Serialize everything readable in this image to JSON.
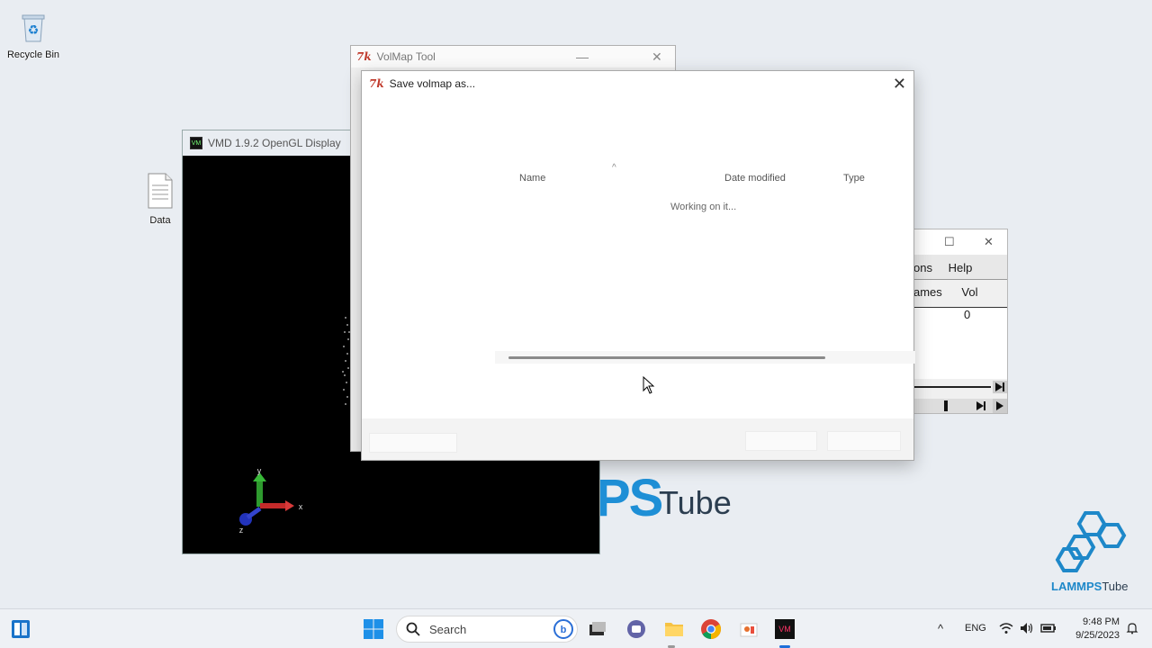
{
  "desktop": {
    "icons": [
      {
        "label": "Recycle Bin",
        "icon": "recycle-bin-icon"
      },
      {
        "label": "Data",
        "icon": "text-file-icon"
      }
    ],
    "wallpaper_brand": {
      "ps": "PS",
      "tube": "Tube",
      "logo_main": "LAMMPS",
      "logo_tube": "Tube"
    }
  },
  "vmd_display": {
    "title": "VMD 1.9.2 OpenGL Display",
    "axes": {
      "x": "x",
      "y": "y",
      "z": "z"
    }
  },
  "vmd_main_partial": {
    "menu": [
      "ons",
      "Help"
    ],
    "columns": [
      "ames",
      "Vol"
    ],
    "rows": [
      {
        "vol": "0"
      }
    ]
  },
  "volmap_tool": {
    "title": "VolMap Tool"
  },
  "save_dialog": {
    "title": "Save volmap as...",
    "columns": {
      "name": "Name",
      "date_modified": "Date modified",
      "type": "Type"
    },
    "status": "Working on it...",
    "close_glyph": "✕"
  },
  "taskbar": {
    "search_placeholder": "Search",
    "language": "ENG",
    "time": "9:48 PM",
    "date": "9/25/2023"
  },
  "colors": {
    "accent": "#1e8fd6",
    "taskbar_bg": "#eef1f5",
    "desktop_bg": "#e9edf2"
  }
}
